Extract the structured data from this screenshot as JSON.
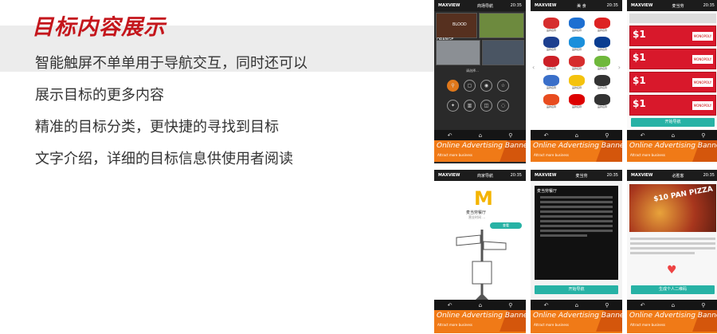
{
  "hero": {
    "title": "目标内容展示",
    "features": [
      "智能触屏不单单用于导航交互，同时还可以",
      "展示目标的更多内容",
      "精准的目标分类，更快捷的寻找到目标",
      "文字介绍，详细的目标信息供使用者阅读"
    ]
  },
  "common": {
    "logo": "MAXVIEW",
    "time": "20:35",
    "ad_title": "Online Advertising Banners",
    "ad_sub": "Attract more business",
    "nav": [
      "返回",
      "首页",
      "搜索"
    ]
  },
  "screens": [
    {
      "title": "商场导航",
      "tiles": [
        "BLOOD ORANGE"
      ],
      "caption": "请选择…"
    },
    {
      "title": "美 食",
      "brands": [
        "品牌名称",
        "品牌名称",
        "品牌名称",
        "品牌名称",
        "品牌名称",
        "品牌名称",
        "品牌名称",
        "品牌名称",
        "品牌名称",
        "品牌名称",
        "品牌名称",
        "品牌名称",
        "品牌名称",
        "品牌名称",
        "品牌名称"
      ],
      "brand_colors": [
        "#d62d2d",
        "#1d6fd1",
        "#d22",
        "#1d3f8f",
        "#1a8fdb",
        "#0a3d91",
        "#cc2027",
        "#d62d2d",
        "#6fb83b",
        "#3a6fc9",
        "#f4c20d",
        "#333",
        "#e84c1f",
        "#d00",
        "#333"
      ]
    },
    {
      "title": "麦当劳",
      "coupon_price": "$1",
      "coupon_count": 4,
      "button": "开始导航",
      "badge": "MONOPOLY"
    },
    {
      "title": "商家导航",
      "name": "麦当劳餐厅",
      "sub": "营业时间 …",
      "chip": "查看"
    },
    {
      "title": "麦当劳",
      "heading": "麦当劳餐厅",
      "button": "开始导航"
    },
    {
      "title": "必胜客",
      "promo": "$10 PAN PIZZA",
      "button": "生成个人二维码"
    }
  ]
}
